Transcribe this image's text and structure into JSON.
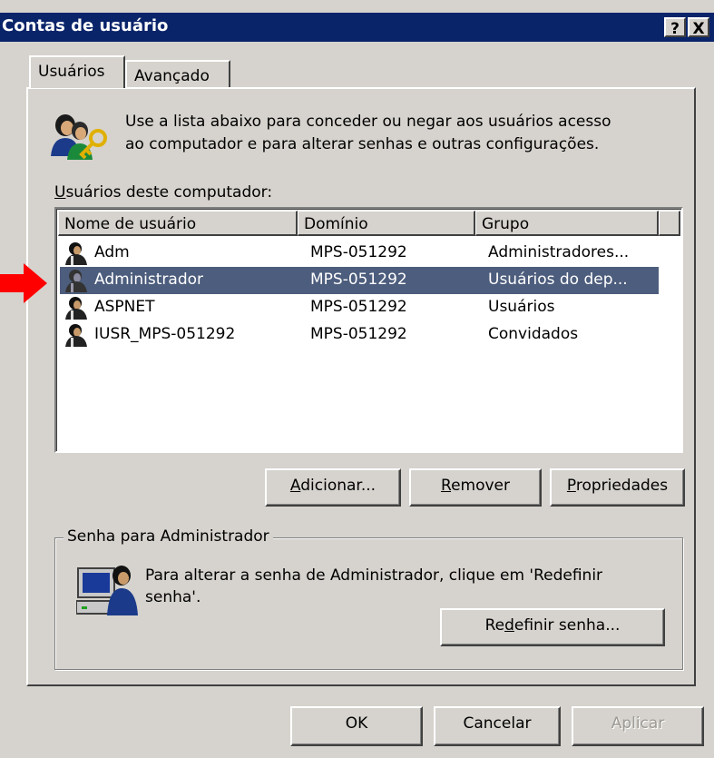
{
  "window": {
    "title": "Contas de usuário",
    "help_button": "?",
    "close_button": "X"
  },
  "tabs": [
    {
      "label": "Usuários",
      "active": true
    },
    {
      "label": "Avançado",
      "active": false
    }
  ],
  "description": {
    "line1": "Use a lista abaixo para conceder ou negar aos usuários acesso",
    "line2": "ao computador e para alterar senhas e outras configurações."
  },
  "users_list": {
    "label_mnemonic": "U",
    "label_rest": "suários deste computador:",
    "columns": [
      "Nome de usuário",
      "Domínio",
      "Grupo"
    ],
    "rows": [
      {
        "name": "Adm",
        "domain": "MPS-051292",
        "group": "Administradores...",
        "selected": false
      },
      {
        "name": "Administrador",
        "domain": "MPS-051292",
        "group": "Usuários do dep...",
        "selected": true
      },
      {
        "name": "ASPNET",
        "domain": "MPS-051292",
        "group": "Usuários",
        "selected": false
      },
      {
        "name": "IUSR_MPS-051292",
        "domain": "MPS-051292",
        "group": "Convidados",
        "selected": false
      }
    ]
  },
  "list_buttons": {
    "add": {
      "mnemonic": "A",
      "rest": "dicionar..."
    },
    "remove": {
      "mnemonic": "R",
      "rest": "emover"
    },
    "properties": {
      "mnemonic": "P",
      "rest": "ropriedades"
    }
  },
  "password_group": {
    "title": "Senha para Administrador",
    "text_line1": "Para alterar a senha de Administrador, clique em 'Redefinir",
    "text_line2": "senha'.",
    "reset_button": {
      "before": "Re",
      "mnemonic": "d",
      "after": "efinir senha..."
    }
  },
  "footer_buttons": {
    "ok": "OK",
    "cancel": "Cancelar",
    "apply": "Aplicar"
  },
  "colors": {
    "title_bar": "#0a246a",
    "selection": "#4d5d7d",
    "face": "#d6d3ce",
    "annotation_arrow": "#ff0000"
  },
  "icons": [
    "users-key-icon",
    "user-icon",
    "computer-user-icon",
    "red-arrow-icon"
  ]
}
